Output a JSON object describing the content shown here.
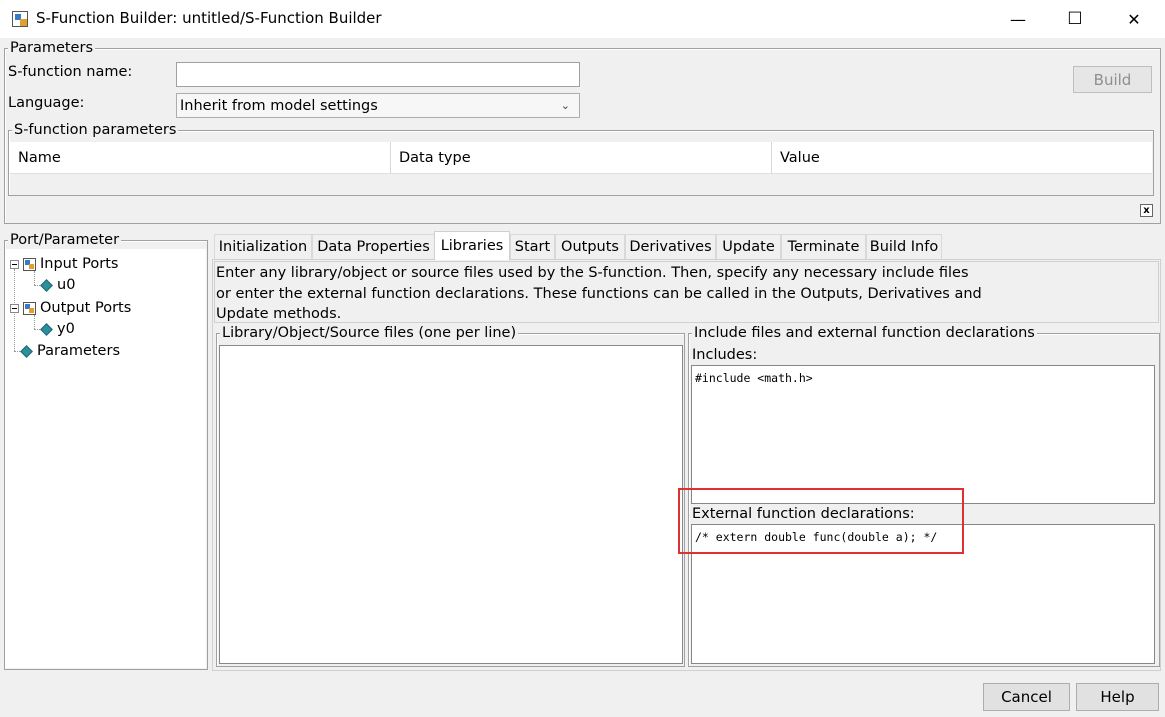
{
  "window": {
    "title": "S-Function Builder: untitled/S-Function Builder",
    "minimize_glyph": "—",
    "maximize_glyph": "☐",
    "close_glyph": "✕"
  },
  "parameters": {
    "legend": "Parameters",
    "sfunction_name_label": "S-function name:",
    "sfunction_name_value": "",
    "language_label": "Language:",
    "language_value": "Inherit from model settings",
    "build_button": "Build",
    "sfunction_parameters": {
      "legend": "S-function parameters",
      "columns": [
        "Name",
        "Data type",
        "Value"
      ],
      "close_glyph": "x"
    }
  },
  "port_parameter": {
    "legend": "Port/Parameter",
    "tree": {
      "input_ports": "Input Ports",
      "u0": "u0",
      "output_ports": "Output Ports",
      "y0": "y0",
      "parameters": "Parameters"
    }
  },
  "tabs": [
    "Initialization",
    "Data Properties",
    "Libraries",
    "Start",
    "Outputs",
    "Derivatives",
    "Update",
    "Terminate",
    "Build Info"
  ],
  "active_tab": "Libraries",
  "libraries": {
    "description": [
      "Enter any library/object or source files used by the S-function. Then, specify any necessary include files",
      "or enter the external function declarations. These functions can be called in the Outputs, Derivatives and",
      "Update methods."
    ],
    "lib_files_legend": "Library/Object/Source files (one per line)",
    "lib_files_value": "",
    "include_legend": "Include files and external function declarations",
    "includes_label": "Includes:",
    "includes_value": "#include <math.h>",
    "external_label": "External function declarations:",
    "external_value": "/* extern double func(double a); */",
    "highlight_color": "#e03030"
  },
  "footer": {
    "cancel_button": "Cancel",
    "help_button": "Help"
  },
  "icons": {
    "app": "s-function-block-icon",
    "block": "port-block-icon",
    "port": "diamond-port-icon"
  }
}
